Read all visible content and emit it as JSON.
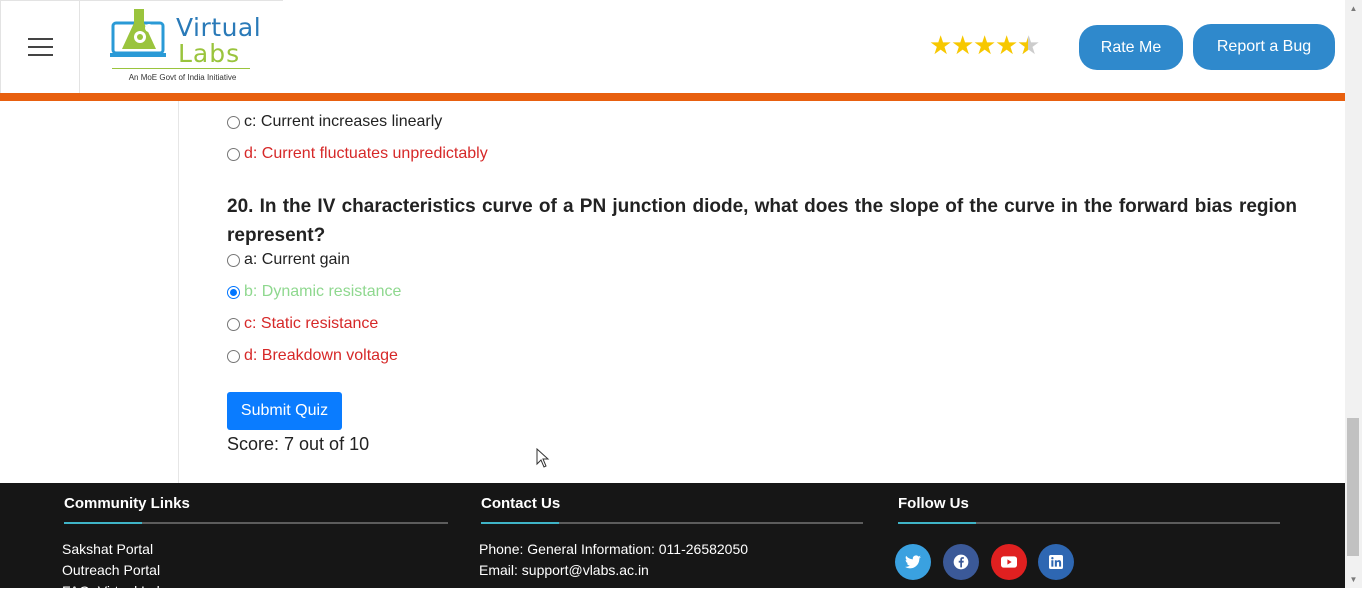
{
  "header": {
    "logo_line1": "Virtual",
    "logo_line2": "Labs",
    "logo_tagline": "An MoE Govt of India Initiative",
    "rating": 4.5,
    "rate_button": "Rate Me",
    "bug_button": "Report a Bug",
    "accent_color": "#e8600f"
  },
  "quiz": {
    "prev_options": [
      {
        "label": "c: Current increases linearly",
        "state": "neutral"
      },
      {
        "label": "d: Current fluctuates unpredictably",
        "state": "incorrect"
      }
    ],
    "question": "20. In the IV characteristics curve of a PN junction diode, what does the slope of the curve in the forward bias region represent?",
    "options": [
      {
        "label": "a: Current gain",
        "state": "neutral",
        "selected": false
      },
      {
        "label": "b: Dynamic resistance",
        "state": "correct",
        "selected": true
      },
      {
        "label": "c: Static resistance",
        "state": "incorrect",
        "selected": false
      },
      {
        "label": "d: Breakdown voltage",
        "state": "incorrect",
        "selected": false
      }
    ],
    "submit_label": "Submit Quiz",
    "score_text": "Score: 7 out of 10"
  },
  "footer": {
    "community": {
      "heading": "Community Links",
      "links": [
        "Sakshat Portal",
        "Outreach Portal",
        "FAQ: Virtual Labs"
      ]
    },
    "contact": {
      "heading": "Contact Us",
      "phone": "Phone: General Information: 011-26582050",
      "email": "Email: support@vlabs.ac.in"
    },
    "follow": {
      "heading": "Follow Us",
      "icons": [
        {
          "name": "twitter-icon",
          "color": "#3aa1e0"
        },
        {
          "name": "facebook-icon",
          "color": "#3b5998"
        },
        {
          "name": "youtube-icon",
          "color": "#e02020"
        },
        {
          "name": "linkedin-icon",
          "color": "#2e67b2"
        }
      ]
    }
  }
}
